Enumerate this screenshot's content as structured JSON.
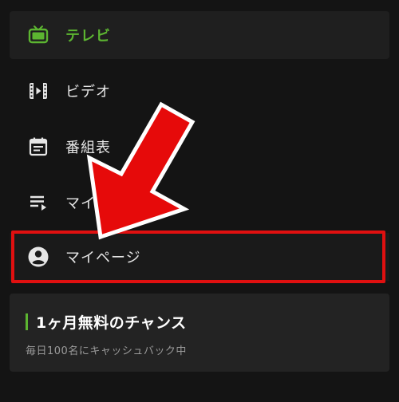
{
  "nav": {
    "items": [
      {
        "label": "テレビ",
        "icon": "tv-icon",
        "active": true
      },
      {
        "label": "ビデオ",
        "icon": "film-icon"
      },
      {
        "label": "番組表",
        "icon": "calendar-icon"
      },
      {
        "label": "マイリスト",
        "icon": "playlist-icon"
      },
      {
        "label": "マイページ",
        "icon": "account-circle-icon"
      }
    ]
  },
  "promo": {
    "title": "1ヶ月無料のチャンス",
    "subtitle": "毎日100名にキャッシュバック中"
  },
  "colors": {
    "background": "#141414",
    "accent_green": "#5cb531",
    "highlight_red": "#e01010"
  }
}
